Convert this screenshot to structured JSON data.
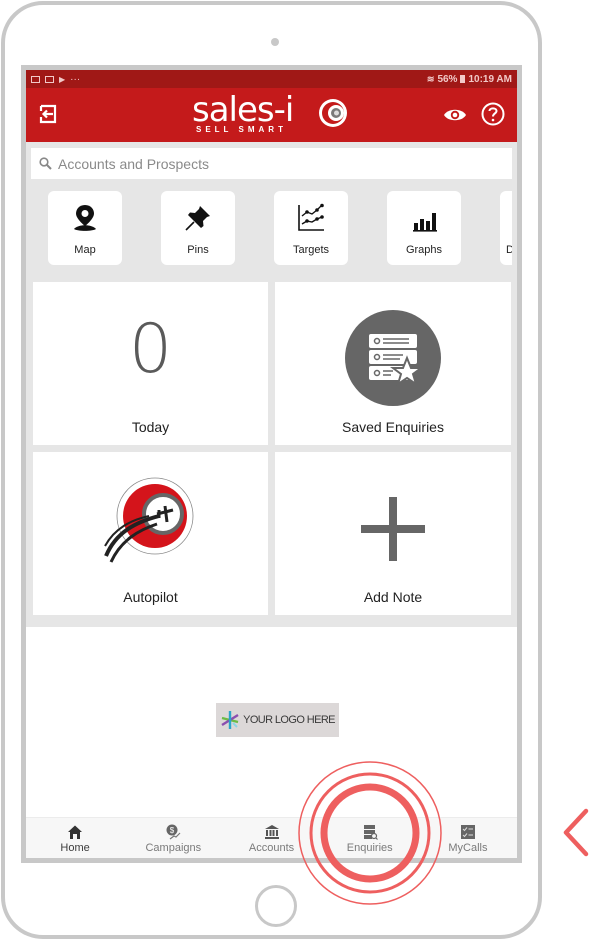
{
  "status_bar": {
    "left_icons": [
      "gallery-icon",
      "notification-icon",
      "play-icon"
    ],
    "overflow": "···",
    "wifi": "wifi-icon",
    "battery": "56%",
    "time": "10:19 AM"
  },
  "header": {
    "brand": "sales-i",
    "tagline": "SELL SMART",
    "exit_icon": "exit-icon",
    "view_icon": "eye-icon",
    "help_icon": "help-icon",
    "brand_color": "#c41a1b"
  },
  "search": {
    "placeholder": "Accounts and Prospects",
    "value": ""
  },
  "shortcuts": [
    {
      "label": "Map",
      "icon": "map-pin-icon"
    },
    {
      "label": "Pins",
      "icon": "pushpin-icon"
    },
    {
      "label": "Targets",
      "icon": "line-chart-icon"
    },
    {
      "label": "Graphs",
      "icon": "bar-chart-icon"
    },
    {
      "label": "D",
      "icon": "partial-icon"
    }
  ],
  "tiles": {
    "today": {
      "count": "0",
      "label": "Today"
    },
    "saved_enquiries": {
      "label": "Saved Enquiries",
      "icon": "saved-enquiries-icon"
    },
    "autopilot": {
      "label": "Autopilot",
      "icon": "autopilot-icon"
    },
    "add_note": {
      "label": "Add Note",
      "icon": "plus-icon"
    }
  },
  "company_logo": {
    "text": "YOUR LOGO HERE"
  },
  "bottom_nav": [
    {
      "label": "Home",
      "icon": "home-icon",
      "active": true
    },
    {
      "label": "Campaigns",
      "icon": "campaigns-icon",
      "active": false
    },
    {
      "label": "Accounts",
      "icon": "bank-icon",
      "active": false
    },
    {
      "label": "Enquiries",
      "icon": "enquiries-icon",
      "active": false
    },
    {
      "label": "MyCalls",
      "icon": "checklist-icon",
      "active": false
    }
  ],
  "overlay": {
    "highlight_target": "Enquiries",
    "highlight_color": "#ee5f5f",
    "back_chevron": "chevron-left-icon"
  }
}
